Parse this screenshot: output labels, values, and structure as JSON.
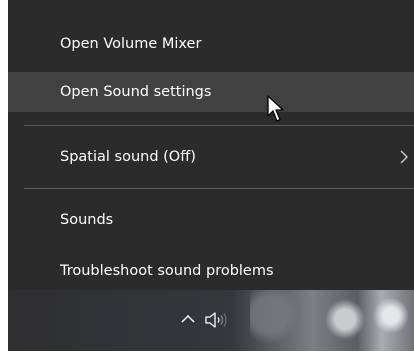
{
  "menu": {
    "items": [
      {
        "label": "Open Volume Mixer"
      },
      {
        "label": "Open Sound settings"
      },
      {
        "label": "Spatial sound (Off)"
      },
      {
        "label": "Sounds"
      },
      {
        "label": "Troubleshoot sound problems"
      }
    ],
    "hovered_item": "Open Sound settings"
  },
  "taskbar": {
    "tray_icons": [
      "chevron-up-icon",
      "speaker-icon"
    ]
  },
  "colors": {
    "menu_bg": "#2b2b2b",
    "hover_bg": "#414141",
    "separator": "#5a5a5a",
    "text": "#ffffff"
  }
}
